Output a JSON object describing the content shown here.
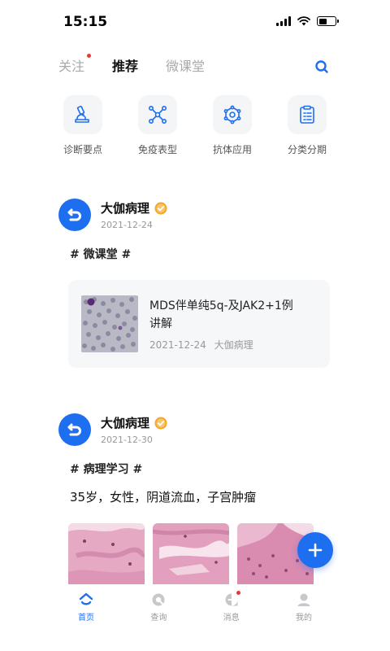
{
  "status": {
    "time": "15:15",
    "battery_level": 0.5
  },
  "tabs": [
    {
      "label": "关注",
      "active": false,
      "has_dot": true
    },
    {
      "label": "推荐",
      "active": true,
      "has_dot": false
    },
    {
      "label": "微课堂",
      "active": false,
      "has_dot": false
    }
  ],
  "categories": [
    {
      "label": "诊断要点",
      "icon": "microscope-icon"
    },
    {
      "label": "免疫表型",
      "icon": "network-icon"
    },
    {
      "label": "抗体应用",
      "icon": "molecule-icon"
    },
    {
      "label": "分类分期",
      "icon": "clipboard-icon"
    }
  ],
  "posts": [
    {
      "author": "大伽病理",
      "date": "2021-12-24",
      "hashtag": "# 微课堂 #",
      "card": {
        "title_line1": "MDS伴单纯5q-及JAK2+1例",
        "title_line2": "讲解",
        "date": "2021-12-24",
        "author": "大伽病理"
      }
    },
    {
      "author": "大伽病理",
      "date": "2021-12-30",
      "hashtag": "# 病理学习 #",
      "text": "35岁，女性，阴道流血，子宫肿瘤"
    }
  ],
  "nav": [
    {
      "label": "首页",
      "icon": "home-icon",
      "active": true
    },
    {
      "label": "查询",
      "icon": "query-icon",
      "active": false
    },
    {
      "label": "消息",
      "icon": "message-icon",
      "active": false,
      "has_dot": true
    },
    {
      "label": "我的",
      "icon": "profile-icon",
      "active": false
    }
  ],
  "colors": {
    "accent": "#1e6ef0",
    "badge": "#e53935",
    "verified": "#f5a623"
  }
}
